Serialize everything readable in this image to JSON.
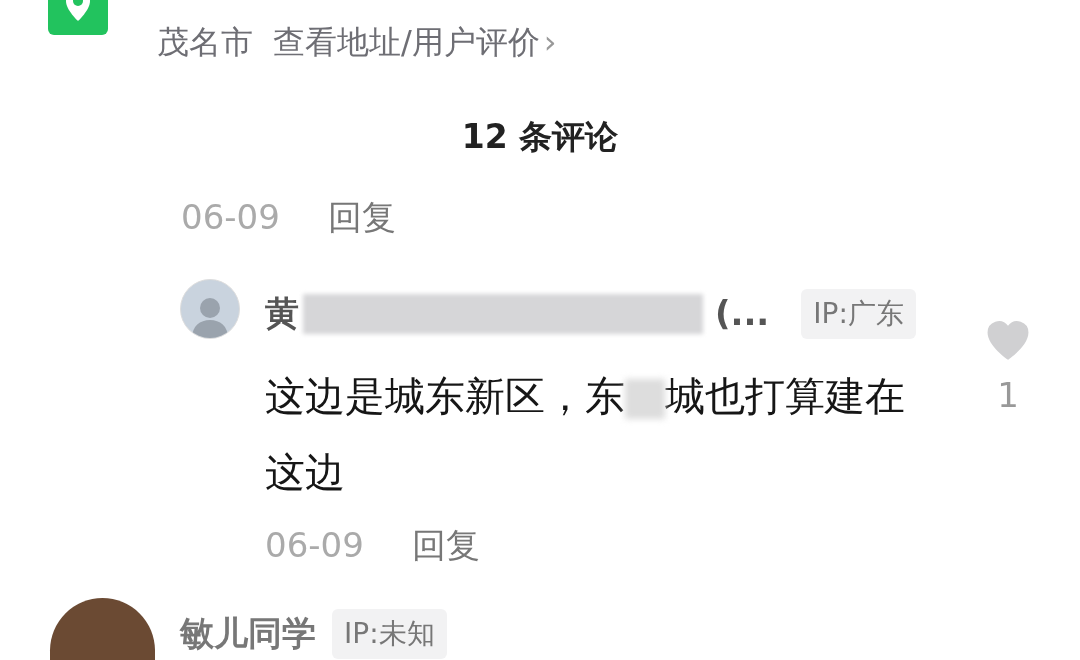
{
  "location": {
    "city": "茂名市",
    "link": "查看地址/用户评价",
    "chevron": "›"
  },
  "comments_header": "12 条评论",
  "parent_meta": {
    "date": "06-09",
    "reply": "回复"
  },
  "reply": {
    "name_prefix": "黄",
    "name_suffix": "(...",
    "ip": "IP:广东",
    "likes": "1",
    "liked": false,
    "text": [
      {
        "kind": "text",
        "value": "这边是城东新区，东"
      },
      {
        "kind": "redacted"
      },
      {
        "kind": "text",
        "value": "城也打算建在这边"
      }
    ],
    "date": "06-09",
    "reply_label": "回复"
  },
  "next_comment": {
    "name": "敏儿同学",
    "ip": "IP:未知"
  }
}
